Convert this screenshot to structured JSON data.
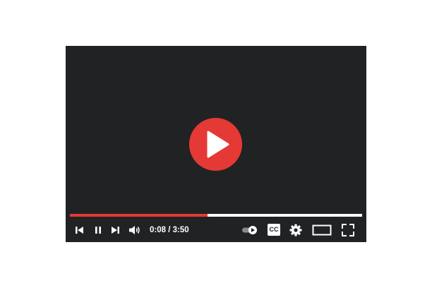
{
  "player": {
    "time": {
      "current": "0:08",
      "separator": " / ",
      "duration": "3:50"
    },
    "progress_fraction": 0.47,
    "captions_label": "CC",
    "colors": {
      "background": "#212224",
      "accent": "#e53935",
      "track": "#ffffff"
    },
    "icons": {
      "big_play": "play-icon",
      "previous": "skip-previous-icon",
      "pause": "pause-icon",
      "next": "skip-next-icon",
      "volume": "volume-icon",
      "autoplay": "autoplay-toggle-icon",
      "captions": "captions-icon",
      "settings": "gear-icon",
      "theater": "theater-mode-icon",
      "fullscreen": "fullscreen-icon"
    }
  }
}
